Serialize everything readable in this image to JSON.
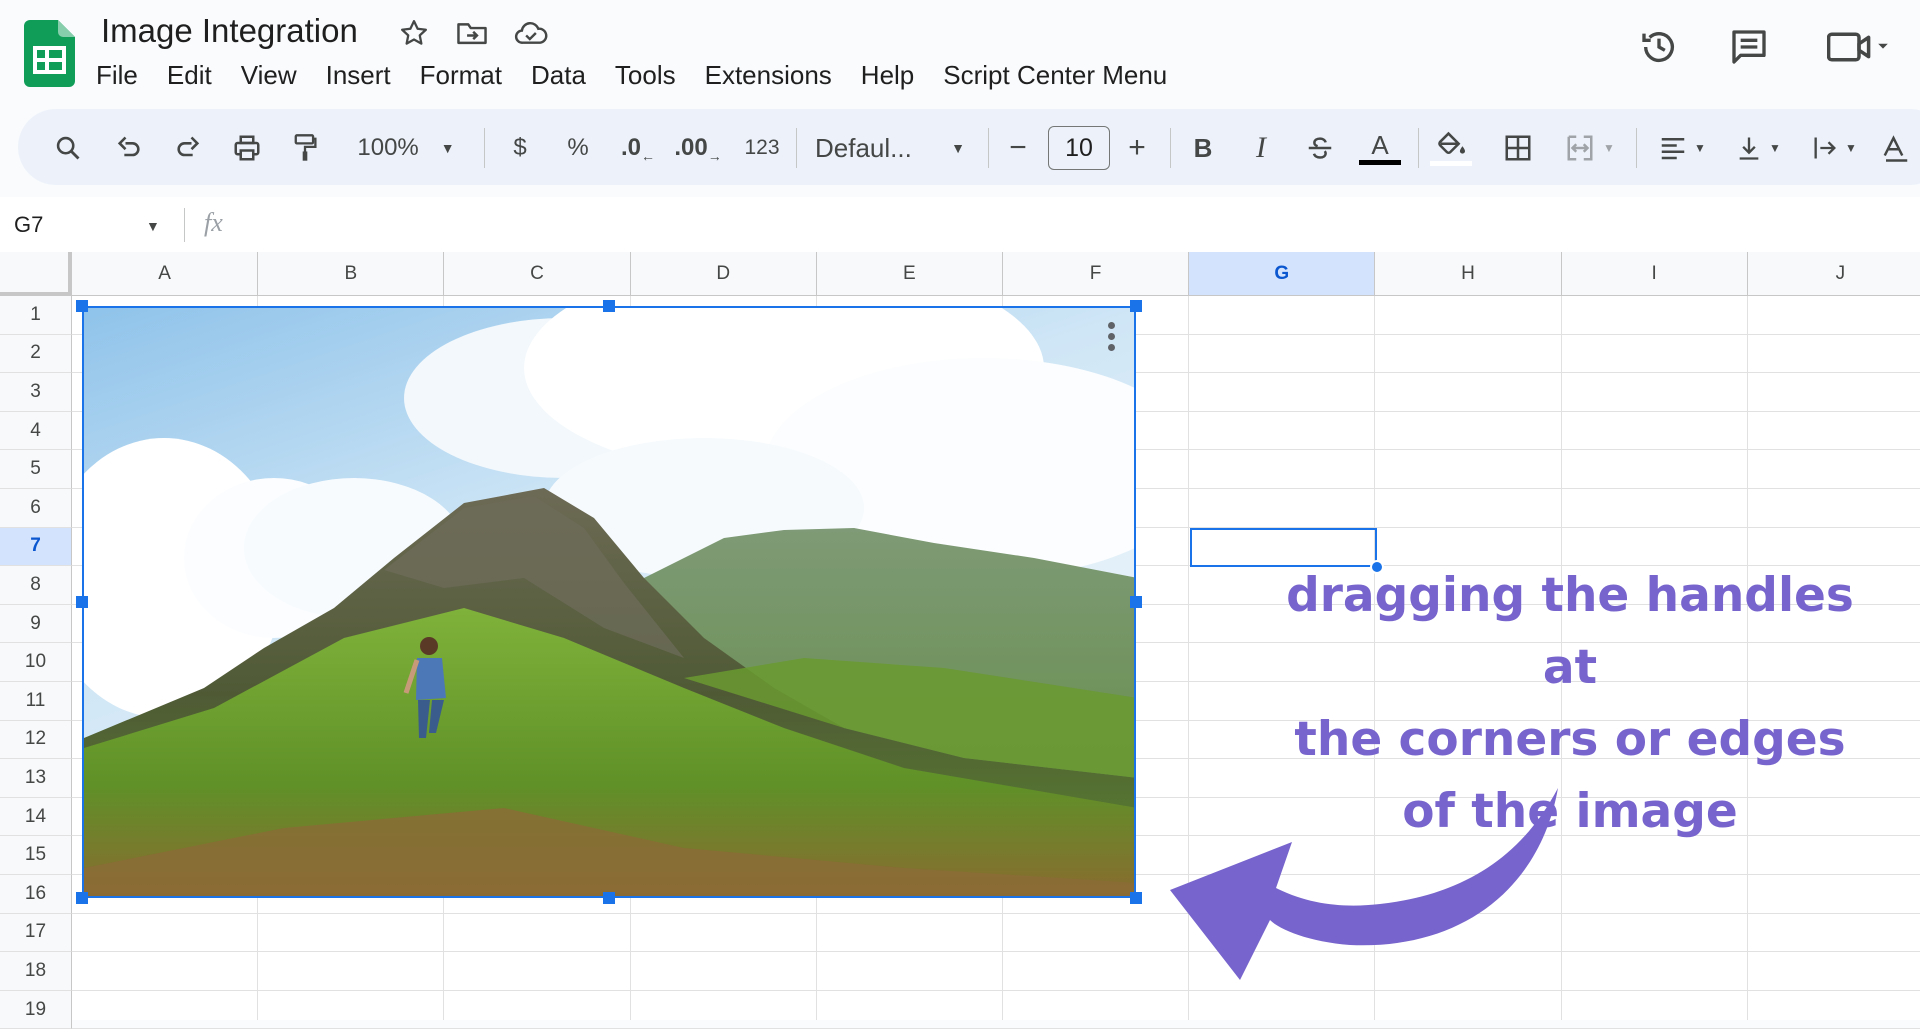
{
  "header": {
    "title": "Image Integration",
    "menu": [
      "File",
      "Edit",
      "View",
      "Insert",
      "Format",
      "Data",
      "Tools",
      "Extensions",
      "Help",
      "Script Center Menu"
    ]
  },
  "toolbar": {
    "zoom": "100%",
    "currency": "$",
    "percent": "%",
    "decrease_decimal": ".0",
    "increase_decimal": ".00",
    "number_format": "123",
    "font": "Defaul...",
    "font_size": "10",
    "minus": "−",
    "plus": "+",
    "bold": "B",
    "italic": "I",
    "text_color_letter": "A"
  },
  "formula_bar": {
    "name_box": "G7",
    "fx": "fx"
  },
  "sheet": {
    "columns": [
      "A",
      "B",
      "C",
      "D",
      "E",
      "F",
      "G",
      "H",
      "I",
      "J"
    ],
    "rows": [
      "1",
      "2",
      "3",
      "4",
      "5",
      "6",
      "7",
      "8",
      "9",
      "10",
      "11",
      "12",
      "13",
      "14",
      "15",
      "16",
      "17",
      "18",
      "19"
    ],
    "selected_column": "G",
    "selected_row": "7"
  },
  "annotation": {
    "lines": [
      "dragging the handles at",
      "the corners or edges",
      "of the image"
    ]
  },
  "colors": {
    "brand_green": "#0f9d58",
    "selection_blue": "#1a73e8",
    "annotation_purple": "#7764cc"
  }
}
